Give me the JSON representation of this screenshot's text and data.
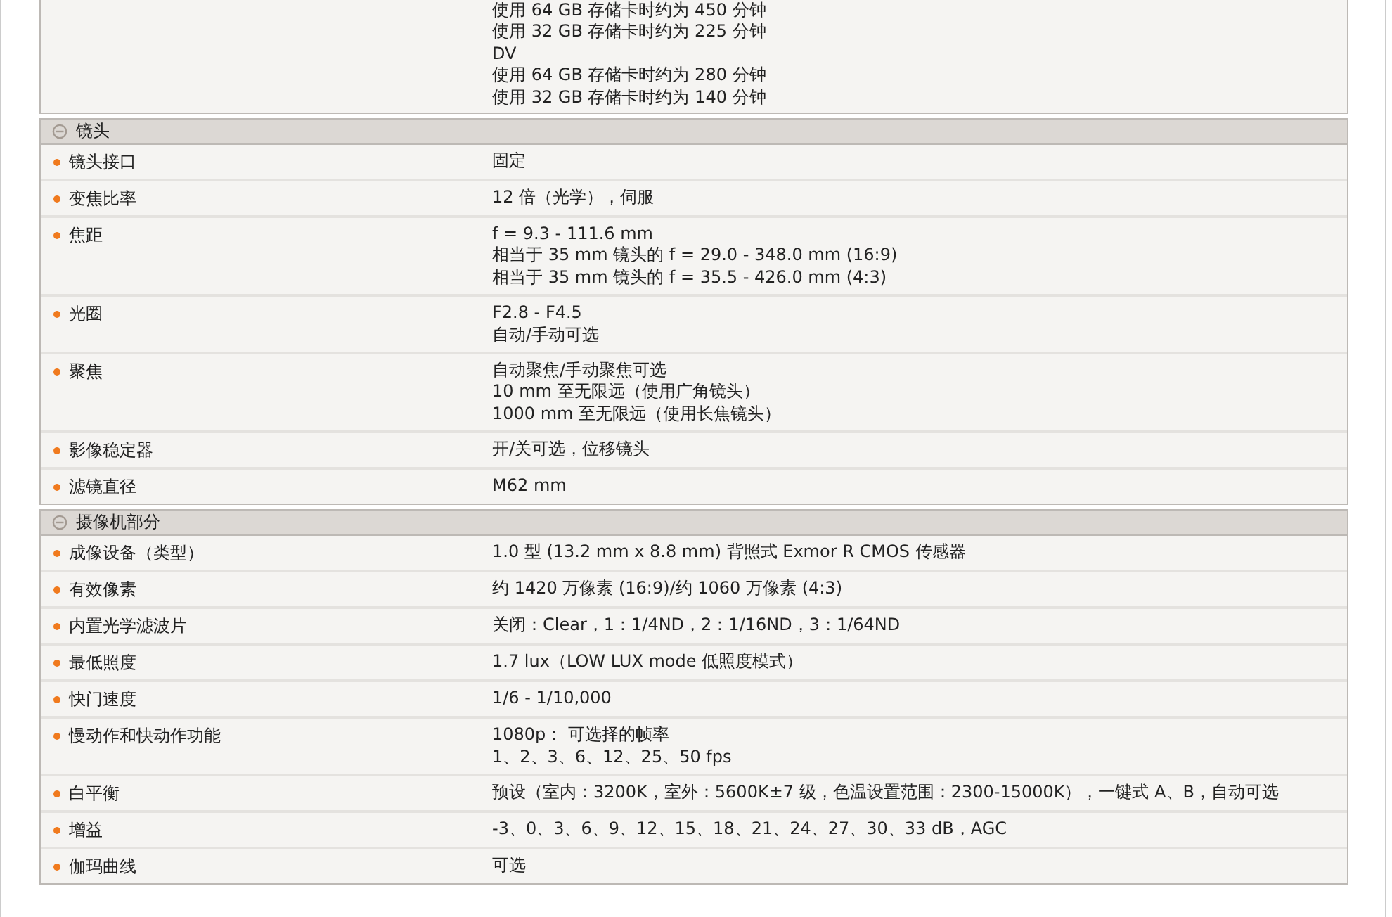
{
  "continued_block": {
    "lines": [
      "使用 64 GB 存储卡时约为 450 分钟",
      "使用 32 GB 存储卡时约为 225 分钟",
      "DV",
      "使用 64 GB 存储卡时约为 280 分钟",
      "使用 32 GB 存储卡时约为 140 分钟"
    ]
  },
  "sections": [
    {
      "title": "镜头",
      "expanded": true,
      "rows": [
        {
          "label": "镜头接口",
          "lines": [
            "固定"
          ]
        },
        {
          "label": "变焦比率",
          "lines": [
            "12 倍（光学），伺服"
          ]
        },
        {
          "label": "焦距",
          "lines": [
            "f = 9.3 - 111.6 mm",
            "相当于 35 mm 镜头的 f = 29.0 - 348.0 mm (16:9)",
            "相当于 35 mm 镜头的 f = 35.5 - 426.0 mm (4:3)"
          ]
        },
        {
          "label": "光圈",
          "lines": [
            "F2.8 - F4.5",
            "自动/手动可选"
          ]
        },
        {
          "label": "聚焦",
          "lines": [
            "自动聚焦/手动聚焦可选",
            "10 mm 至无限远（使用广角镜头）",
            "1000 mm 至无限远（使用长焦镜头）"
          ]
        },
        {
          "label": "影像稳定器",
          "lines": [
            "开/关可选，位移镜头"
          ]
        },
        {
          "label": "滤镜直径",
          "lines": [
            "M62 mm"
          ]
        }
      ]
    },
    {
      "title": "摄像机部分",
      "expanded": true,
      "rows": [
        {
          "label": "成像设备（类型）",
          "lines": [
            "1.0 型 (13.2 mm x 8.8 mm) 背照式 Exmor R CMOS 传感器"
          ]
        },
        {
          "label": "有效像素",
          "lines": [
            "约 1420 万像素 (16:9)/约 1060 万像素 (4:3)"
          ]
        },
        {
          "label": "内置光学滤波片",
          "lines": [
            "关闭：Clear，1：1/4ND，2：1/16ND，3：1/64ND"
          ]
        },
        {
          "label": "最低照度",
          "lines": [
            "1.7 lux（LOW LUX mode 低照度模式）"
          ]
        },
        {
          "label": "快门速度",
          "lines": [
            "1/6 - 1/10,000"
          ]
        },
        {
          "label": "慢动作和快动作功能",
          "lines": [
            "1080p： 可选择的帧率",
            "1、2、3、6、12、25、50 fps"
          ]
        },
        {
          "label": "白平衡",
          "lines": [
            "预设（室内：3200K，室外：5600K±7 级，色温设置范围：2300-15000K），一键式 A、B，自动可选"
          ]
        },
        {
          "label": "增益",
          "lines": [
            "-3、0、3、6、9、12、15、18、21、24、27、30、33 dB，AGC"
          ]
        },
        {
          "label": "伽玛曲线",
          "lines": [
            "可选"
          ]
        }
      ]
    }
  ]
}
